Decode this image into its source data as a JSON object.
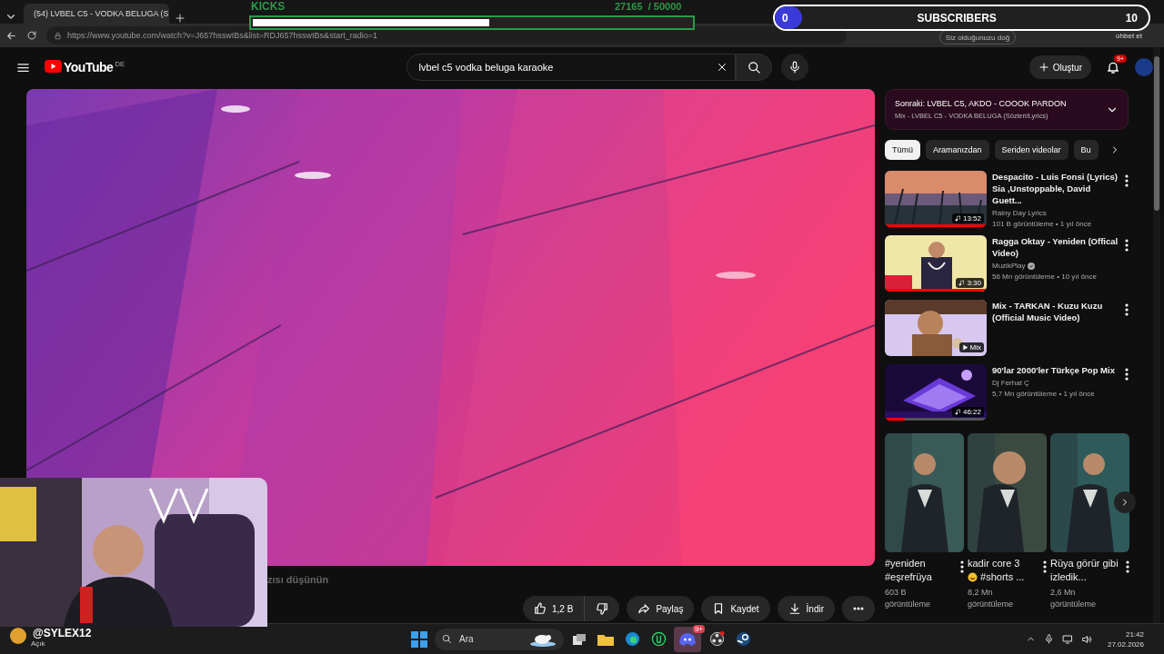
{
  "browser": {
    "tab_title": "(54) LVBEL C5 - VODKA BELUGA (S",
    "url": "https://www.youtube.com/watch?v=J657hsswIBs&list=RDJ657hsswIBs&start_radio=1",
    "address_hint": "Siz olduğunuzu doğ",
    "chat_button": "ohbet et"
  },
  "youtube": {
    "logo": "YouTube",
    "region": "DE",
    "search": {
      "value": "lvbel c5 vodka beluga karaoke"
    },
    "create": "Oluştur",
    "notifications": "9+",
    "description_fragment": "zısı düşünün",
    "actions": [
      {
        "kind": "like",
        "label": "1,2 B"
      },
      {
        "kind": "dislike"
      },
      {
        "kind": "share",
        "label": "Paylaş"
      },
      {
        "kind": "save",
        "label": "Kaydet"
      },
      {
        "kind": "download",
        "label": "İndir"
      },
      {
        "kind": "more"
      }
    ],
    "playlist": {
      "next": "Sonraki: LVBEL C5, AKDO - COOOK PARDON",
      "title": "Mix - LVBEL C5 - VODKA BELUGA (Sözleri/Lyrics)"
    },
    "chips": [
      {
        "label": "Tümü",
        "selected": true
      },
      {
        "label": "Aramanızdan",
        "selected": false
      },
      {
        "label": "Seriden videolar",
        "selected": false
      },
      {
        "label": "Bu",
        "selected": false
      }
    ],
    "videos": [
      {
        "kind": "video",
        "title": "Despacito - Luis Fonsi (Lyrics) Sia ,Unstoppable, David Guett...",
        "channel": "Rainy Day Lyrics",
        "verified": false,
        "meta": "101 B görüntüleme • 1 yıl önce",
        "duration": "13:52",
        "level": 1
      },
      {
        "kind": "video",
        "title": "Ragga Oktay - Yeniden (Offical Video)",
        "channel": "MuzikPlay",
        "verified": true,
        "meta": "56 Mn görüntüleme • 10 yıl önce",
        "duration": "3:30",
        "level": 1
      },
      {
        "kind": "mix",
        "title": "Mix - TARKAN - Kuzu Kuzu (Official Music Video)",
        "badge": "Mix"
      },
      {
        "kind": "video",
        "title": "90'lar 2000'ler Türkçe Pop Mix",
        "channel": "Dj Ferhat Ç",
        "verified": false,
        "meta": "5,7 Mn görüntüleme • 1 yıl önce",
        "duration": "46:22",
        "level": 0.2
      }
    ],
    "shorts": [
      {
        "title": "#yeniden #eşrefrüya",
        "emoji": false,
        "views": "603 B görüntüleme"
      },
      {
        "title": "kadir core 3",
        "title_2": "#shorts ...",
        "emoji": true,
        "views": "8,2 Mn görüntüleme"
      },
      {
        "title": "Rüya görür gibi izledik...",
        "emoji": false,
        "views": "2,6 Mn görüntüleme"
      }
    ]
  },
  "stream": {
    "kicks": {
      "label": "KICKS",
      "current": "27165",
      "goal": "/ 50000",
      "level": 0.54
    },
    "subs": {
      "current": "0",
      "label": "SUBSCRIBERS",
      "goal": "10",
      "level": 0
    },
    "streamer": "@SYLEX12",
    "streamer_status": "Açık"
  },
  "taskbar": {
    "search": "Ara",
    "discord_badge": "9+",
    "time": "21:42",
    "date": "27.02.2026"
  }
}
